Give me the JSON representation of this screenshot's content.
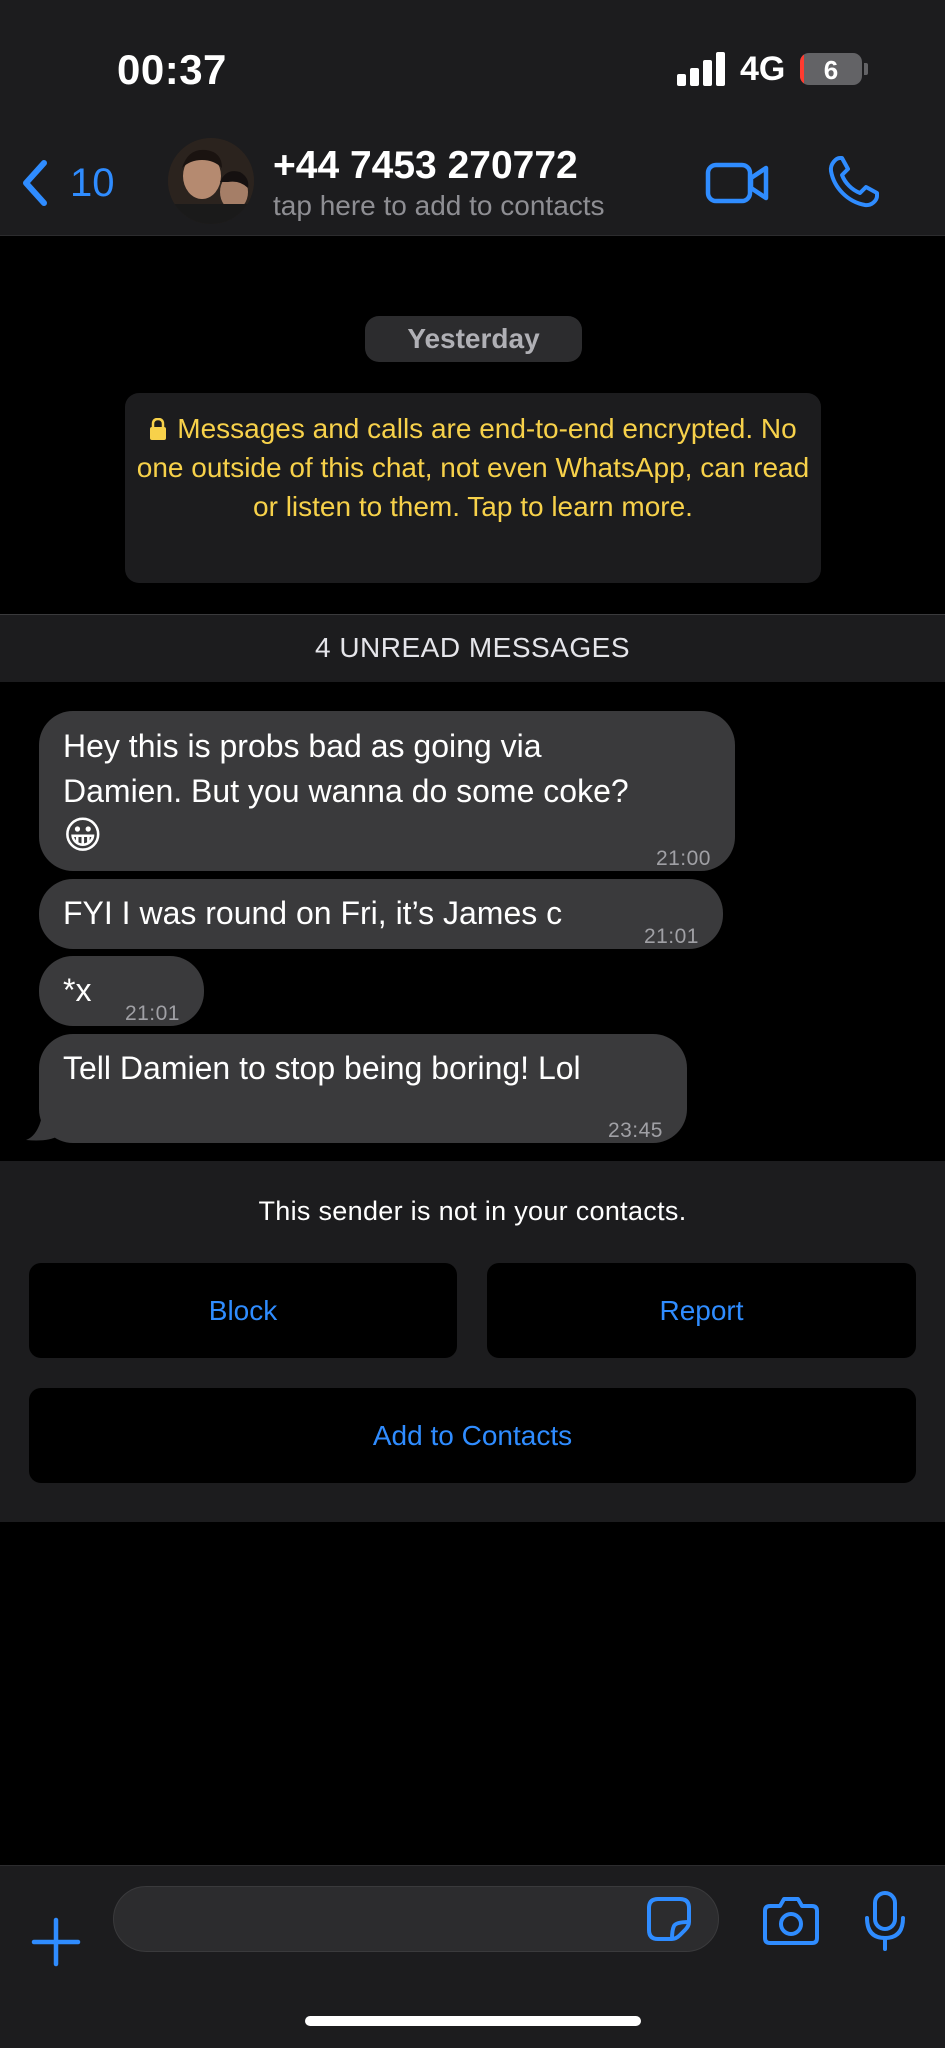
{
  "status_bar": {
    "time": "00:37",
    "network": "4G",
    "battery": "6",
    "battery_level_percent": 6
  },
  "header": {
    "back_count": "10",
    "contact_name": "+44 7453 270772",
    "contact_subtitle": "tap here to add to contacts",
    "accent_color": "#2f8cff"
  },
  "chat": {
    "date_label": "Yesterday",
    "encryption_notice": "Messages and calls are end-to-end encrypted. No one outside of this chat, not even WhatsApp, can read or listen to them. Tap to learn more.",
    "encryption_color": "#f7d14a",
    "unread_label": "4 UNREAD MESSAGES",
    "messages": [
      {
        "line1": "Hey this is probs bad as going via",
        "line2": "Damien. But you wanna do some coke?",
        "emoji": "😀",
        "time": "21:00"
      },
      {
        "text": "FYI I was round on Fri, it’s James c",
        "time": "21:01"
      },
      {
        "text": "*x",
        "time": "21:01"
      },
      {
        "text": "Tell Damien to stop being boring! Lol",
        "time": "23:45"
      }
    ]
  },
  "unknown_sender": {
    "note": "This sender is not in your contacts.",
    "block_label": "Block",
    "report_label": "Report",
    "add_label": "Add to Contacts"
  },
  "input_bar": {
    "placeholder": "",
    "icons": [
      "plus-icon",
      "sticker-icon",
      "camera-icon",
      "microphone-icon"
    ]
  }
}
